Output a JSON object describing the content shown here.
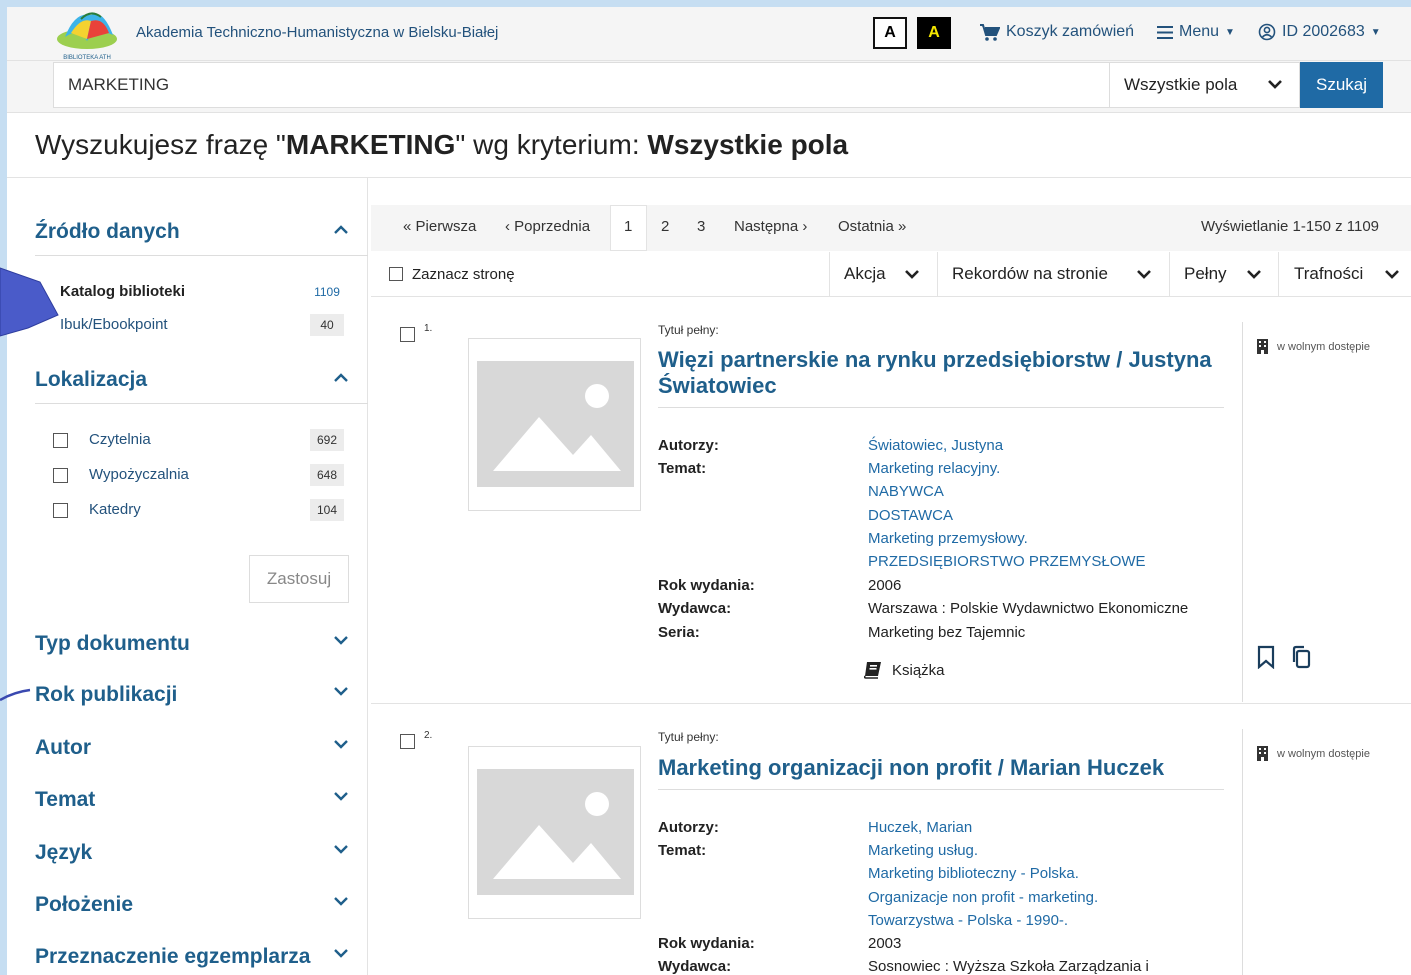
{
  "header": {
    "library_name": "Akademia Techniczno-Humanistyczna w Bielsku-Białej",
    "logo_text": "BIBLIOTEKA ATH",
    "contrast_normal": "A",
    "contrast_high": "A",
    "cart_label": "Koszyk zamówień",
    "menu_label": "Menu",
    "user_label": "ID 2002683"
  },
  "search": {
    "value": "MARKETING",
    "field_select": "Wszystkie pola",
    "button_label": "Szukaj"
  },
  "headline": {
    "prefix": "Wyszukujesz frazę \"",
    "phrase": "MARKETING",
    "middle": "\" wg kryterium: ",
    "criterion": "Wszystkie pola"
  },
  "facets": {
    "source": {
      "title": "Źródło danych",
      "items": [
        {
          "label": "Katalog biblioteki",
          "count": "1109"
        },
        {
          "label": "Ibuk/Ebookpoint",
          "count": "40"
        }
      ]
    },
    "location": {
      "title": "Lokalizacja",
      "items": [
        {
          "label": "Czytelnia",
          "count": "692"
        },
        {
          "label": "Wypożyczalnia",
          "count": "648"
        },
        {
          "label": "Katedry",
          "count": "104"
        }
      ],
      "apply_label": "Zastosuj"
    },
    "collapsed": [
      "Typ dokumentu",
      "Rok publikacji",
      "Autor",
      "Temat",
      "Język",
      "Położenie",
      "Przeznaczenie egzemplarza"
    ]
  },
  "pager": {
    "first": "« Pierwsza",
    "prev": "‹ Poprzednia",
    "pages": [
      "1",
      "2",
      "3"
    ],
    "next": "Następna ›",
    "last": "Ostatnia »",
    "summary": "Wyświetlanie 1-150 z 1109"
  },
  "toolbar": {
    "select_page": "Zaznacz stronę",
    "action": "Akcja",
    "per_page": "Rekordów na stronie",
    "view": "Pełny",
    "sort": "Trafności"
  },
  "records": [
    {
      "num": "1.",
      "title_label": "Tytuł pełny:",
      "title_line1": "Więzi partnerskie na rynku przedsiębiorstw / Justyna",
      "title_line2": "Światowiec",
      "authors_label": "Autorzy:",
      "authors": "Światowiec, Justyna",
      "subject_label": "Temat:",
      "subjects": [
        "Marketing relacyjny.",
        "NABYWCA",
        "DOSTAWCA",
        "Marketing przemysłowy.",
        "PRZEDSIĘBIORSTWO PRZEMYSŁOWE"
      ],
      "year_label": "Rok wydania:",
      "year": "2006",
      "publisher_label": "Wydawca:",
      "publisher": "Warszawa : Polskie Wydawnictwo Ekonomiczne",
      "series_label": "Seria:",
      "series": "Marketing bez Tajemnic",
      "doc_type": "Książka",
      "access": "w wolnym dostępie"
    },
    {
      "num": "2.",
      "title_label": "Tytuł pełny:",
      "title_line1": "Marketing organizacji non profit / Marian Huczek",
      "authors_label": "Autorzy:",
      "authors": "Huczek, Marian",
      "subject_label": "Temat:",
      "subjects": [
        "Marketing usług.",
        "Marketing biblioteczny - Polska.",
        "Organizacje non profit - marketing.",
        "Towarzystwa - Polska - 1990-."
      ],
      "year_label": "Rok wydania:",
      "year": "2003",
      "publisher_label": "Wydawca:",
      "publisher": "Sosnowiec : Wyższa Szkoła Zarządzania i",
      "access": "w wolnym dostępie"
    }
  ],
  "colors": {
    "accent": "#1f6aa5",
    "link": "#1f5f8b",
    "frame": "#c6def2",
    "arrow": "#4a5bc9"
  }
}
